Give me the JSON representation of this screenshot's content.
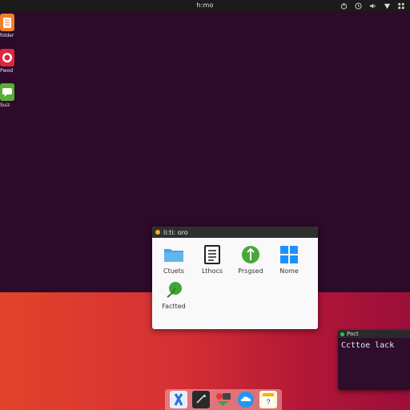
{
  "topbar": {
    "clock": "h:mo",
    "tray_icons": [
      "power-icon",
      "clock-icon",
      "volume-icon",
      "network-icon",
      "system-menu-icon"
    ]
  },
  "desktop_icons": [
    {
      "label": "folder",
      "icon": "notes-icon",
      "color": "#f07f25"
    },
    {
      "label": "Pwod",
      "icon": "media-icon",
      "color": "#e0263f"
    },
    {
      "label": "Suiz",
      "icon": "chat-icon",
      "color": "#5aad35"
    }
  ],
  "window": {
    "title": "li:ti: oro",
    "items": [
      {
        "label": "Ctuets",
        "icon": "folder-icon"
      },
      {
        "label": "Lthocs",
        "icon": "document-icon"
      },
      {
        "label": "Prsgsed",
        "icon": "green-app-icon"
      },
      {
        "label": "Nome",
        "icon": "windows-grid-icon"
      },
      {
        "label": "Factted",
        "icon": "green-leaf-icon"
      }
    ]
  },
  "terminal": {
    "title": "Pact",
    "line": "Ccttoe lack"
  },
  "dock": {
    "items": [
      "settings-icon",
      "terminal-icon",
      "apps-icon",
      "cloud-icon",
      "notes-icon"
    ]
  },
  "colors": {
    "wallpaper_top": "#2c0a2a",
    "wallpaper_bottom_left": "#e3432a",
    "wallpaper_bottom_right": "#9c0f3a",
    "accent": "#f0b323"
  }
}
